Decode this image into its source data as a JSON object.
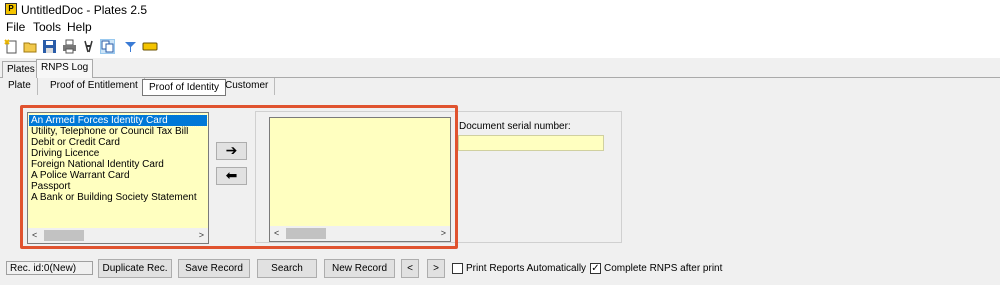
{
  "window": {
    "title": "UntitledDoc - Plates 2.5",
    "app_icon_letter": "P"
  },
  "menu": {
    "file": "File",
    "tools": "Tools",
    "help": "Help"
  },
  "toolbar": {
    "icons": [
      "new-icon",
      "open-icon",
      "save-icon",
      "print-icon",
      "scissors-icon",
      "copy-icon",
      "filter-icon",
      "label-icon"
    ]
  },
  "main_tabs": {
    "plates": "Plates",
    "rnps_log": "RNPS Log"
  },
  "sub_tabs": {
    "plate": "Plate",
    "proof_entitlement": "Proof of Entitlement",
    "proof_identity": "Proof of Identity",
    "customer": "Customer"
  },
  "identity_list": {
    "items": [
      "An Armed Forces Identity Card",
      "Utility, Telephone or Council Tax Bill",
      "Debit or Credit Card",
      "Driving Licence",
      "Foreign National Identity Card",
      "A Police Warrant Card",
      "Passport",
      "A Bank or Building Society Statement"
    ],
    "selected_index": 0
  },
  "arrows": {
    "add": "➔",
    "remove": "⬅"
  },
  "document": {
    "serial_label": "Document serial number:",
    "serial_value": ""
  },
  "status": {
    "record_id": "Rec. id:0(New)"
  },
  "buttons": {
    "duplicate": "Duplicate Rec.",
    "save": "Save Record",
    "search": "Search",
    "new": "New Record",
    "prev": "<",
    "next": ">"
  },
  "options": {
    "print_auto_label": "Print Reports Automatically",
    "print_auto_checked": false,
    "complete_rnps_label": "Complete RNPS after print",
    "complete_rnps_checked": true
  },
  "colors": {
    "list_bg": "#ffffc0",
    "selection": "#0078d7",
    "highlight_border": "#e0532f"
  }
}
